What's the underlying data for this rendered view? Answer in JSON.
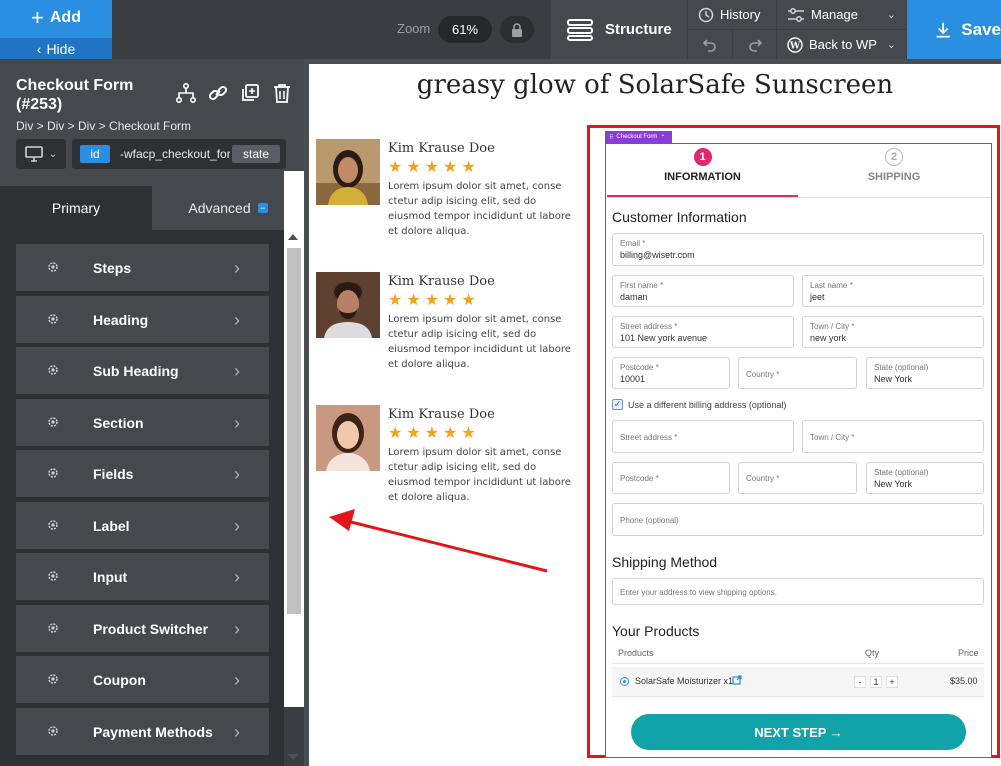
{
  "topbar": {
    "add_label": "Add",
    "hide_label": "Hide",
    "zoom_label": "Zoom",
    "zoom_value": "61%",
    "structure_label": "Structure",
    "history_label": "History",
    "manage_label": "Manage",
    "back_label": "Back to WP",
    "save_label": "Save"
  },
  "panel": {
    "element_title": "Checkout Form (#253)",
    "breadcrumb": "Div > Div > Div > Checkout Form",
    "selector_id": "id",
    "selector_text": "-wfacp_checkout_for",
    "selector_state": "state",
    "tab_primary": "Primary",
    "tab_advanced": "Advanced",
    "sections": [
      {
        "label": "Steps"
      },
      {
        "label": "Heading"
      },
      {
        "label": "Sub Heading"
      },
      {
        "label": "Section"
      },
      {
        "label": "Fields"
      },
      {
        "label": "Label"
      },
      {
        "label": "Input"
      },
      {
        "label": "Product Switcher"
      },
      {
        "label": "Coupon"
      },
      {
        "label": "Payment Methods"
      }
    ]
  },
  "canvas": {
    "page_title": "greasy glow of SolarSafe Sunscreen",
    "reviews": [
      {
        "name": "Kim Krause Doe",
        "stars": "★★★★★",
        "text": "Lorem ipsum dolor sit amet, conse ctetur adip isicing elit, sed do eiusmod tempor incididunt ut labore et dolore aliqua."
      },
      {
        "name": "Kim Krause Doe",
        "stars": "★★★★★",
        "text": "Lorem ipsum dolor sit amet, conse ctetur adip isicing elit, sed do eiusmod tempor incididunt ut labore et dolore aliqua."
      },
      {
        "name": "Kim Krause Doe",
        "stars": "★★★★★",
        "text": "Lorem ipsum dolor sit amet, conse ctetur adip isicing elit, sed do eiusmod tempor incididunt ut labore et dolore aliqua."
      }
    ],
    "form": {
      "tag_label": "Checkout Form",
      "step1_num": "1",
      "step1_label": "INFORMATION",
      "step2_num": "2",
      "step2_label": "SHIPPING",
      "customer_title": "Customer Information",
      "email_label": "Email *",
      "email_value": "billing@wisetr.com",
      "first_label": "First name *",
      "first_value": "daman",
      "last_label": "Last name *",
      "last_value": "jeet",
      "street_label": "Street address *",
      "street_value": "101 New york avenue",
      "town_label": "Town / City *",
      "town_value": "new york",
      "postcode_label": "Postcode *",
      "postcode_value": "10001",
      "country_label": "Country *",
      "state_label": "State (optional)",
      "state_value": "New York",
      "billing_check_label": "Use a different billing address (optional)",
      "b_street_label": "Street address *",
      "b_town_label": "Town / City *",
      "b_postcode_label": "Postcode *",
      "b_country_label": "Country *",
      "b_state_label": "State (optional)",
      "b_state_value": "New York",
      "phone_label": "Phone (optional)",
      "shipping_title": "Shipping Method",
      "shipping_note": "Enter your address to view shipping options.",
      "products_title": "Your Products",
      "col_products": "Products",
      "col_qty": "Qty",
      "col_price": "Price",
      "product_name": "SolarSafe Moisturizer x1",
      "qty_minus": "-",
      "qty_value": "1",
      "qty_plus": "+",
      "product_price": "$35.00",
      "next_label": "NEXT STEP →"
    }
  },
  "colors": {
    "accent_blue": "#2a8fe0",
    "step_pink": "#e0266f",
    "star": "#f0a31c",
    "highlight_red": "#e3151a",
    "button_teal": "#11a3a8",
    "form_purple": "#8a3cd6"
  }
}
